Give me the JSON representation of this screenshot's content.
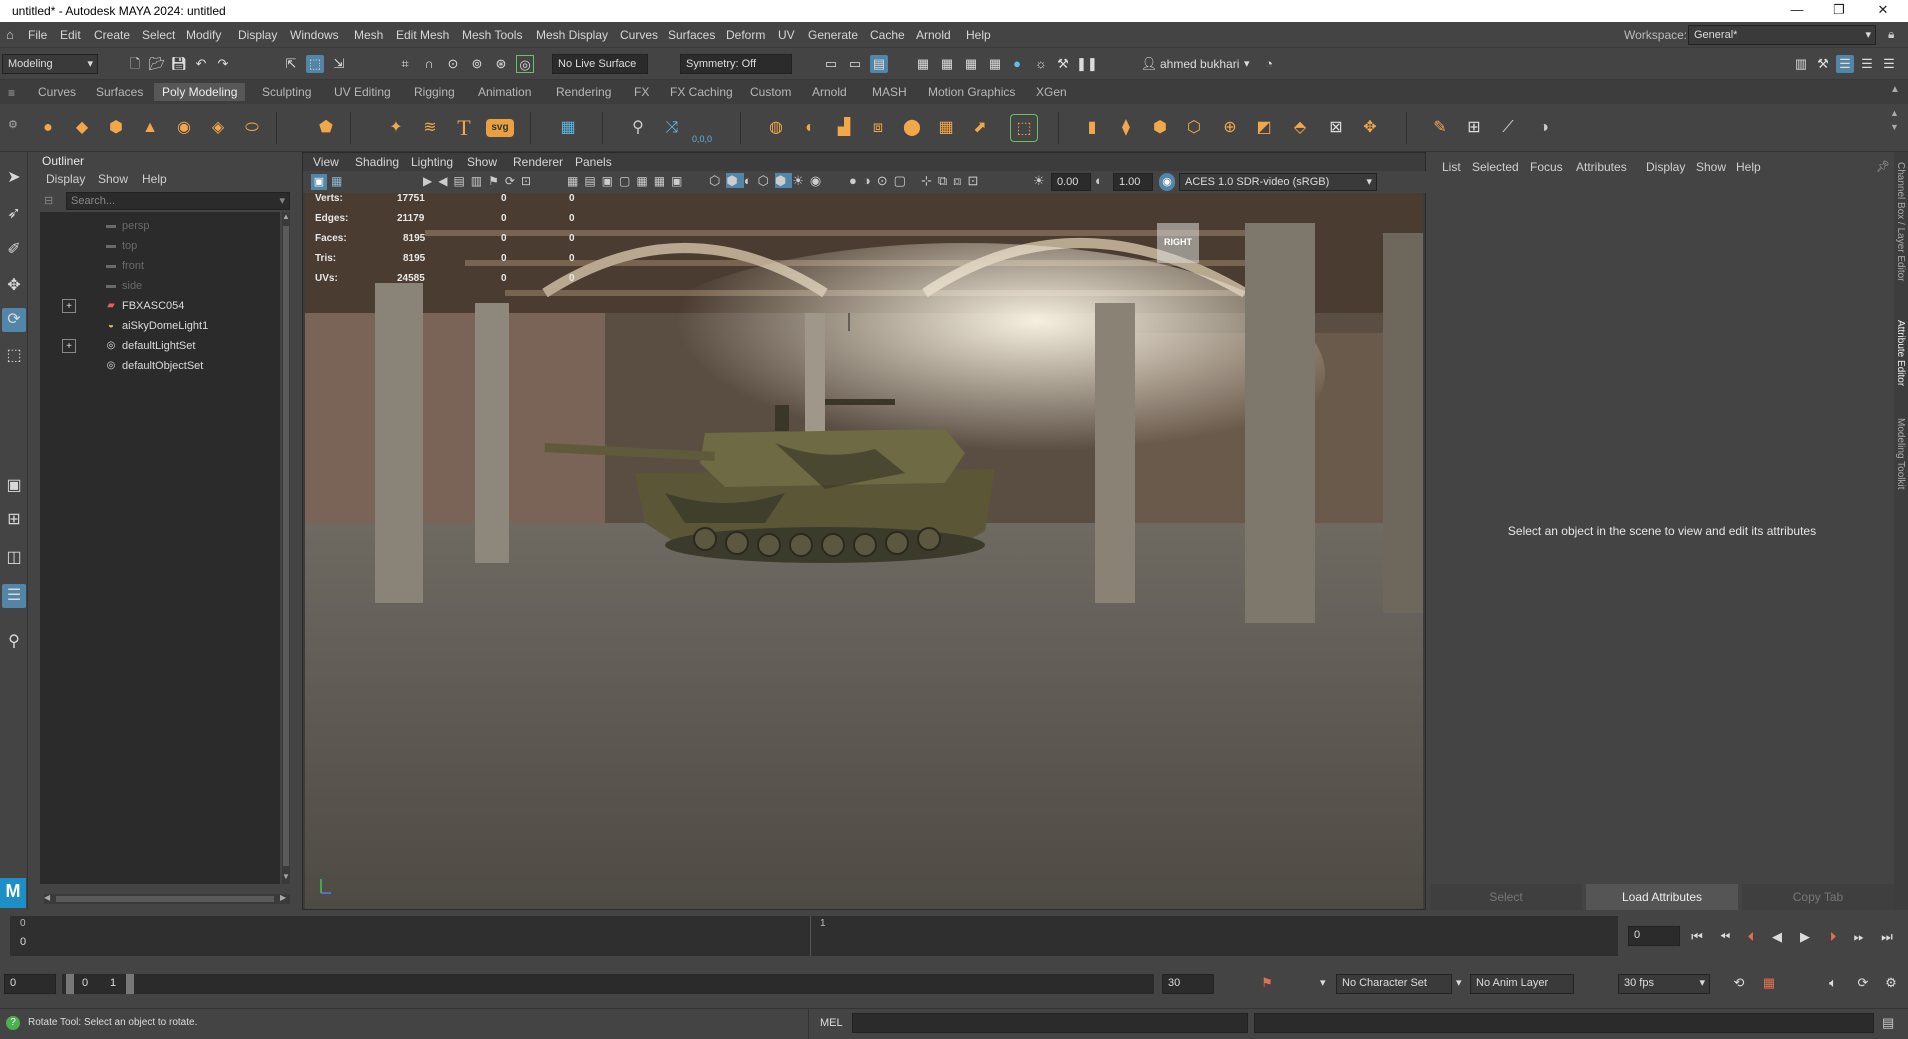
{
  "window": {
    "title": "untitled* - Autodesk MAYA 2024: untitled",
    "minimize": "—",
    "maximize": "❐",
    "close": "✕"
  },
  "menu": [
    "File",
    "Edit",
    "Create",
    "Select",
    "Modify",
    "Display",
    "Windows",
    "Mesh",
    "Edit Mesh",
    "Mesh Tools",
    "Mesh Display",
    "Curves",
    "Surfaces",
    "Deform",
    "UV",
    "Generate",
    "Cache",
    "Arnold",
    "Help"
  ],
  "workspace": {
    "label": "Workspace:",
    "value": "General*"
  },
  "status_line": {
    "mode": "Modeling",
    "live_surface": "No Live Surface",
    "symmetry": "Symmetry: Off",
    "user": "ahmed bukhari"
  },
  "shelf_tabs": [
    "Curves",
    "Surfaces",
    "Poly Modeling",
    "Sculpting",
    "UV Editing",
    "Rigging",
    "Animation",
    "Rendering",
    "FX",
    "FX Caching",
    "Custom",
    "Arnold",
    "MASH",
    "Motion Graphics",
    "XGen"
  ],
  "shelf_active": "Poly Modeling",
  "shelf_icons": [
    "sphere-icon",
    "cube-icon",
    "cylinder-icon",
    "cone-icon",
    "torus-icon",
    "plane-icon",
    "disc-icon",
    "platonic-icon",
    "super-shape-icon",
    "sweep-mesh-icon",
    "type-icon",
    "svg-icon",
    "plane-grid-icon",
    "combine-icon",
    "separate-icon",
    "smooth-icon",
    "extract-icon",
    "boolean-icon",
    "mirror-icon",
    "bevel-icon",
    "bridge-icon",
    "extrude-icon",
    "bevel2-icon",
    "fill-hole-icon",
    "multicut-icon",
    "target-weld-icon",
    "connect-icon",
    "knife-icon",
    "center-pivot-icon",
    "freeze-icon",
    "delete-history-icon",
    "poke-icon",
    "wedge-icon",
    "merge-icon",
    "triangulate-icon",
    "quadrangulate-icon",
    "pen-icon",
    "lattice-icon",
    "sculpt-icon"
  ],
  "shelf_svg_label": "svg",
  "shelf_type_label": "T",
  "shelf_xyz_label": "0,0,0",
  "outliner": {
    "title": "Outliner",
    "menu": [
      "Display",
      "Show",
      "Help"
    ],
    "search_placeholder": "Search...",
    "items": [
      {
        "label": "persp",
        "dim": true,
        "icon": "camera-icon"
      },
      {
        "label": "top",
        "dim": true,
        "icon": "camera-icon"
      },
      {
        "label": "front",
        "dim": true,
        "icon": "camera-icon"
      },
      {
        "label": "side",
        "dim": true,
        "icon": "camera-icon"
      },
      {
        "label": "FBXASC054",
        "dim": false,
        "icon": "group-icon",
        "expand": true
      },
      {
        "label": "aiSkyDomeLight1",
        "dim": false,
        "icon": "dome-light-icon"
      },
      {
        "label": "defaultLightSet",
        "dim": false,
        "icon": "set-icon",
        "expand": true
      },
      {
        "label": "defaultObjectSet",
        "dim": false,
        "icon": "set-icon"
      }
    ]
  },
  "viewport": {
    "menu": [
      "View",
      "Shading",
      "Lighting",
      "Show",
      "Renderer",
      "Panels"
    ],
    "exposure": "0.00",
    "gamma": "1.00",
    "color_space": "ACES 1.0 SDR-video (sRGB)",
    "view_cube": "RIGHT",
    "hud": [
      {
        "label": "Verts:",
        "value": "17751",
        "sel": "0",
        "comp": "0"
      },
      {
        "label": "Edges:",
        "value": "21179",
        "sel": "0",
        "comp": "0"
      },
      {
        "label": "Faces:",
        "value": "8195",
        "sel": "0",
        "comp": "0"
      },
      {
        "label": "Tris:",
        "value": "8195",
        "sel": "0",
        "comp": "0"
      },
      {
        "label": "UVs:",
        "value": "24585",
        "sel": "0",
        "comp": "0"
      }
    ]
  },
  "attribute_editor": {
    "menu": [
      "List",
      "Selected",
      "Focus",
      "Attributes",
      "Display",
      "Show",
      "Help"
    ],
    "message": "Select an object in the scene to view and edit its attributes",
    "buttons": [
      "Select",
      "Load Attributes",
      "Copy Tab"
    ],
    "active_button": "Load Attributes"
  },
  "side_tabs": [
    "Channel Box / Layer Editor",
    "Attribute Editor",
    "Modeling Toolkit"
  ],
  "time_slider": {
    "start_tick": "0",
    "mid_tick": "1",
    "current_left": "0",
    "current_frame": "0"
  },
  "range_slider": {
    "start": "0",
    "inner_start": "0",
    "inner_end": "1",
    "end": "30",
    "character_set": "No Character Set",
    "anim_layer": "No Anim Layer",
    "fps": "30 fps"
  },
  "help_line": {
    "message": "Rotate Tool: Select an object to rotate.",
    "command_lang": "MEL"
  },
  "logo": "M",
  "colors": {
    "bg": "#444444",
    "panel_dark": "#2b2b2b",
    "accent_blue": "#5285a6",
    "shelf_orange": "#f0a84b"
  }
}
